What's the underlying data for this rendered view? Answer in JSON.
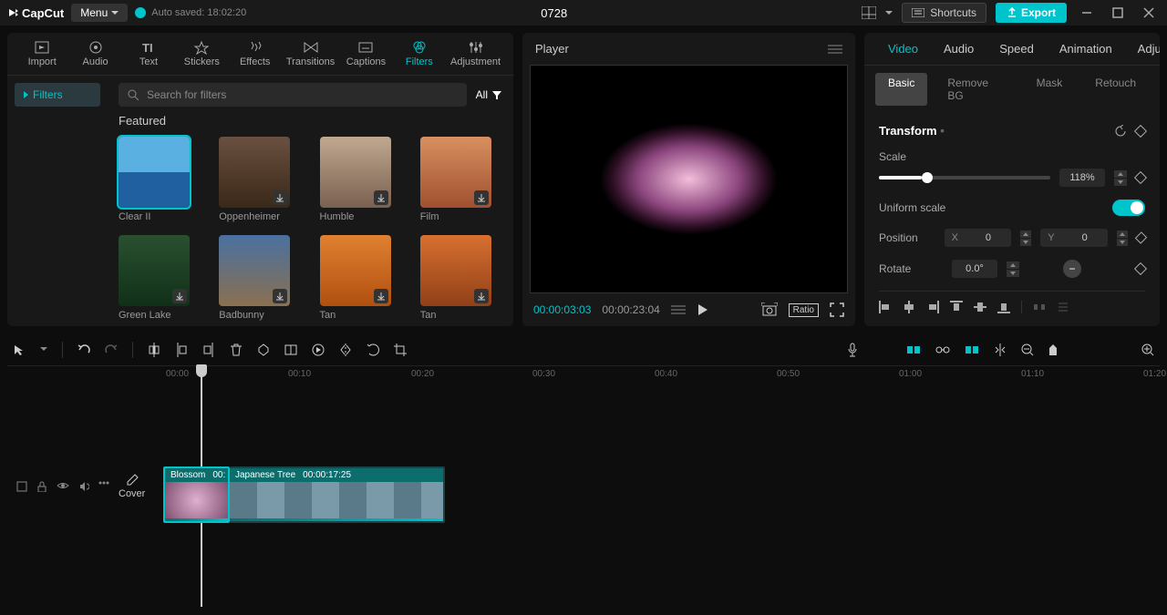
{
  "topbar": {
    "logo": "CapCut",
    "menu": "Menu",
    "autosave": "Auto saved: 18:02:20",
    "title": "0728",
    "shortcuts": "Shortcuts",
    "export": "Export"
  },
  "toolTabs": [
    "Import",
    "Audio",
    "Text",
    "Stickers",
    "Effects",
    "Transitions",
    "Captions",
    "Filters",
    "Adjustment"
  ],
  "activeToolTab": "Filters",
  "sidebarItem": "Filters",
  "searchPlaceholder": "Search for filters",
  "allBtn": "All",
  "sectionTitle": "Featured",
  "filters": [
    {
      "label": "Clear II",
      "sel": true
    },
    {
      "label": "Oppenheimer"
    },
    {
      "label": "Humble"
    },
    {
      "label": "Film"
    },
    {
      "label": "Green Lake"
    },
    {
      "label": "Badbunny"
    },
    {
      "label": "Tan"
    },
    {
      "label": "Tan"
    }
  ],
  "player": {
    "title": "Player",
    "current": "00:00:03:03",
    "total": "00:00:23:04",
    "ratio": "Ratio"
  },
  "inspector": {
    "tabs": [
      "Video",
      "Audio",
      "Speed",
      "Animation",
      "Adjustment"
    ],
    "activeTab": "Video",
    "subtabs": [
      "Basic",
      "Remove BG",
      "Mask",
      "Retouch"
    ],
    "activeSub": "Basic",
    "transform": "Transform",
    "scale": "Scale",
    "scaleValue": "118%",
    "uniform": "Uniform scale",
    "position": "Position",
    "posX": "0",
    "posY": "0",
    "rotate": "Rotate",
    "rotateValue": "0.0°"
  },
  "timeline": {
    "ticks": [
      "00:00",
      "00:10",
      "00:20",
      "00:30",
      "00:40",
      "00:50",
      "01:00",
      "01:10",
      "01:20"
    ],
    "cover": "Cover",
    "clip1": {
      "name": "Blossom",
      "dur": "00:"
    },
    "clip2": {
      "name": "Japanese Tree",
      "dur": "00:00:17:25"
    }
  }
}
